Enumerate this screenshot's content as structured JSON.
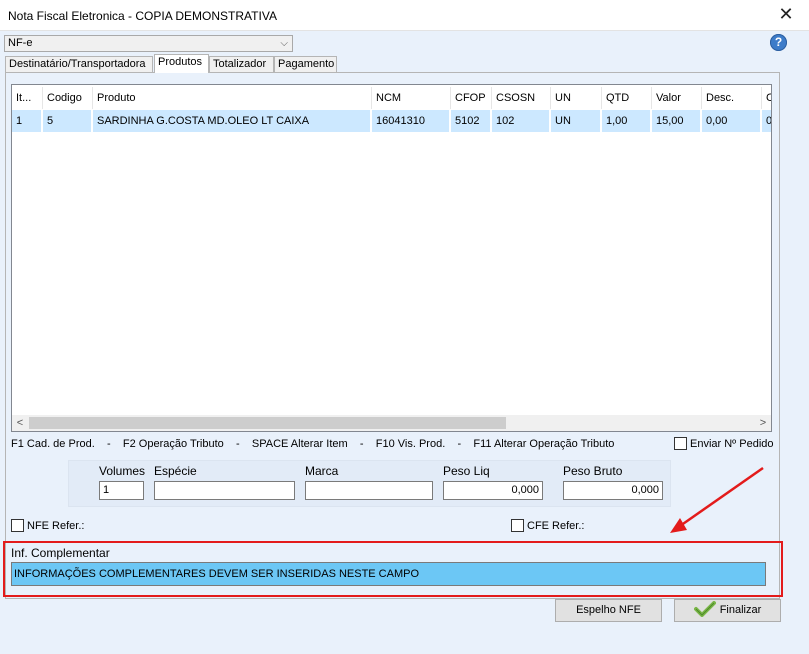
{
  "window": {
    "title": "Nota Fiscal Eletronica - COPIA DEMONSTRATIVA",
    "close_glyph": "✕"
  },
  "doc_type_select": {
    "value": "NF-e",
    "chevron": "⌵"
  },
  "help": {
    "glyph": "?"
  },
  "tabs": [
    {
      "label": "Destinatário/Transportadora",
      "active": false
    },
    {
      "label": "Produtos",
      "active": true
    },
    {
      "label": "Totalizador",
      "active": false
    },
    {
      "label": "Pagamento",
      "active": false
    }
  ],
  "products_table": {
    "columns": [
      "It...",
      "Codigo",
      "Produto",
      "NCM",
      "CFOP",
      "CSOSN",
      "UN",
      "QTD",
      "Valor",
      "Desc.",
      "C"
    ],
    "rows": [
      [
        "1",
        "5",
        "SARDINHA G.COSTA MD.OLEO LT CAIXA",
        "16041310",
        "5102",
        "102",
        "UN",
        "1,00",
        "15,00",
        "0,00",
        "0,"
      ]
    ],
    "scroll_left": "<",
    "scroll_right": ">"
  },
  "shortcuts": "F1 Cad. de Prod.    -    F2 Operação Tributo    -    SPACE Alterar Item    -    F10 Vis. Prod.    -    F11 Alterar Operação Tributo",
  "enviar_pedido": {
    "label": "Enviar Nº Pedido",
    "checked": false
  },
  "volumes": {
    "labels": {
      "volumes": "Volumes",
      "especie": "Espécie",
      "marca": "Marca",
      "peso_liq": "Peso Liq",
      "peso_bruto": "Peso Bruto"
    },
    "values": {
      "volumes": "1",
      "especie": "",
      "marca": "",
      "peso_liq": "0,000",
      "peso_bruto": "0,000"
    }
  },
  "nfe_refer": {
    "label": "NFE Refer.:",
    "checked": false
  },
  "cfe_refer": {
    "label": "CFE Refer.:",
    "checked": false
  },
  "inf_complementar": {
    "label": "Inf. Complementar",
    "value": "INFORMAÇÕES COMPLEMENTARES DEVEM SER INSERIDAS NESTE CAMPO"
  },
  "buttons": {
    "espelho": "Espelho NFE",
    "finalizar": "Finalizar"
  },
  "colors": {
    "highlight_border": "#e31b1b",
    "inf_field_bg": "#6cc7f5",
    "row_selected": "#cce8ff"
  }
}
